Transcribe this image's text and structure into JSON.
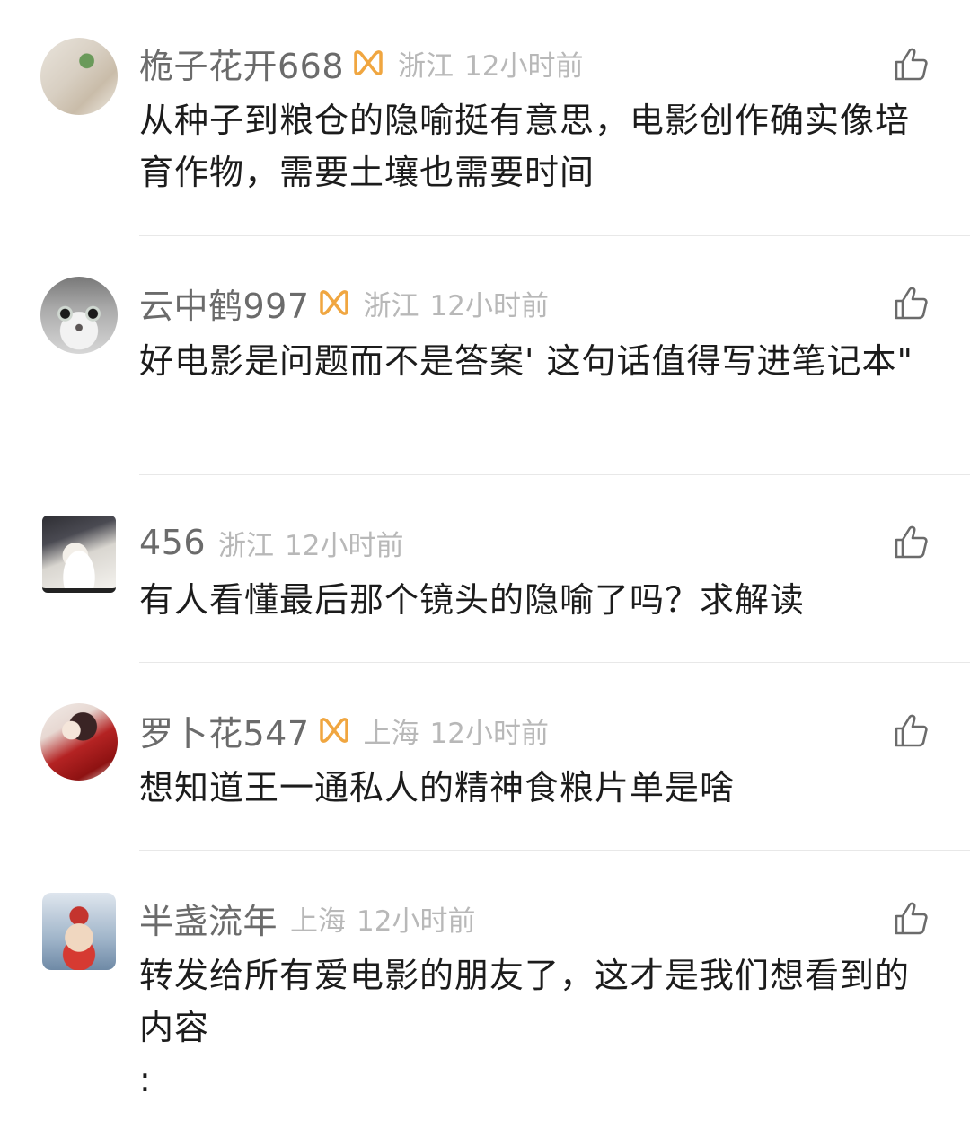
{
  "comments": [
    {
      "username": "桅子花开668",
      "vip": true,
      "location": "浙江",
      "time": "12小时前",
      "text": "从种子到粮仓的隐喻挺有意思，电影创作确实像培育作物，需要土壤也需要时间",
      "avatar": "avatar-plant"
    },
    {
      "username": "云中鹤997",
      "vip": true,
      "location": "浙江",
      "time": "12小时前",
      "text": "好电影是问题而不是答案' 这句话值得写进笔记本\"",
      "avatar": "avatar-cat"
    },
    {
      "username": "456",
      "vip": false,
      "location": "浙江",
      "time": "12小时前",
      "text": "有人看懂最后那个镜头的隐喻了吗？求解读",
      "avatar": "avatar-anime-boy"
    },
    {
      "username": "罗卜花547",
      "vip": true,
      "location": "上海",
      "time": "12小时前",
      "text": "想知道王一通私人的精神食粮片单是啥",
      "avatar": "avatar-anime-red"
    },
    {
      "username": "半盏流年",
      "vip": false,
      "location": "上海",
      "time": "12小时前",
      "text": "转发给所有爱电影的朋友了，这才是我们想看到的内容\n:",
      "avatar": "avatar-cartoon-ox"
    }
  ],
  "colors": {
    "vip_badge": "#f0a640",
    "username": "#6b6b6b",
    "meta": "#b8b8b8",
    "text": "#1c1c1c",
    "divider": "#e8e8e8"
  },
  "icons": {
    "like": "thumbs-up-icon",
    "vip": "vip-badge-icon"
  }
}
